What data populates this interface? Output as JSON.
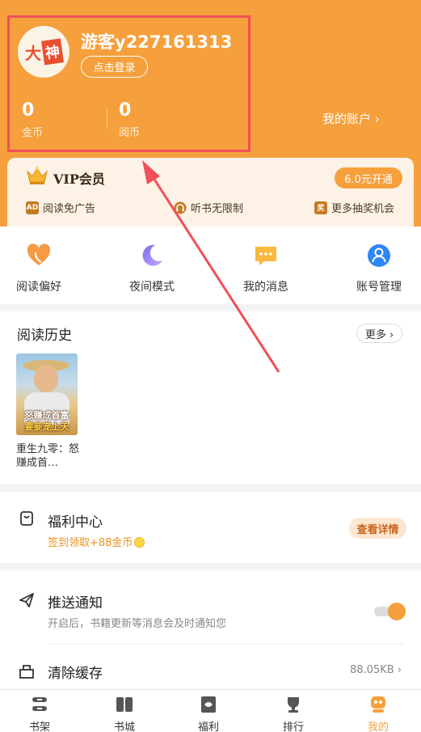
{
  "colors": {
    "accent": "#f5a03c",
    "annotation": "#f0505a"
  },
  "profile": {
    "avatar_text_1": "大",
    "avatar_text_2": "神",
    "username": "游客y227161313",
    "login_label": "点击登录",
    "gold_value": "0",
    "gold_label": "金币",
    "yue_value": "0",
    "yue_label": "阅币",
    "account_label": "我的账户 ›"
  },
  "vip": {
    "title": "VIP会员",
    "open_label": "6.0元开通",
    "perks": [
      {
        "icon": "ad-icon",
        "icon_text": "AD",
        "label": "阅读免广告"
      },
      {
        "icon": "headphone-icon",
        "icon_text": "",
        "label": "听书无限制"
      },
      {
        "icon": "lottery-icon",
        "icon_text": "奖",
        "label": "更多抽奖机会"
      }
    ]
  },
  "quick": [
    {
      "icon": "heart-icon",
      "label": "阅读偏好"
    },
    {
      "icon": "moon-icon",
      "label": "夜间模式"
    },
    {
      "icon": "message-icon",
      "label": "我的消息"
    },
    {
      "icon": "account-icon",
      "label": "账号管理"
    }
  ],
  "history": {
    "title": "阅读历史",
    "more_label": "更多 ›",
    "book": {
      "cover_line_1": "怒赚成首富",
      "cover_line_2": "要妾宠上天",
      "title": "重生九零：怒赚成首…"
    }
  },
  "welfare": {
    "title": "福利中心",
    "subtitle": "签到领取+88金币",
    "detail_label": "查看详情"
  },
  "settings": {
    "push_title": "推送通知",
    "push_sub": "开启后，书籍更新等消息会及时通知您",
    "push_enabled": true,
    "cache_title": "清除缓存",
    "cache_size": "88.05KB ›"
  },
  "tabs": [
    {
      "icon": "bookshelf-icon",
      "label": "书架",
      "active": false
    },
    {
      "icon": "bookstore-icon",
      "label": "书城",
      "active": false
    },
    {
      "icon": "welfare-icon",
      "label": "福利",
      "active": false
    },
    {
      "icon": "ranking-icon",
      "label": "排行",
      "active": false
    },
    {
      "icon": "profile-icon",
      "label": "我的",
      "active": true
    }
  ]
}
